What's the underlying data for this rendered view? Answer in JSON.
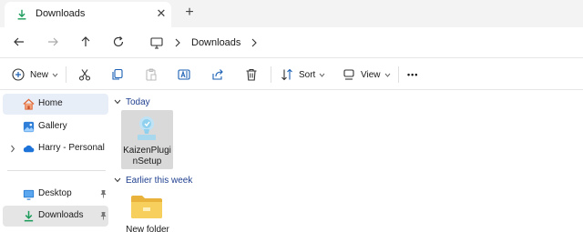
{
  "tab": {
    "title": "Downloads",
    "icon": "download-icon",
    "close_glyph": "✕",
    "new_tab_glyph": "+"
  },
  "address": {
    "path_label": "Downloads",
    "root_icon": "this-pc-icon"
  },
  "toolbar": {
    "new_label": "New",
    "sort_label": "Sort",
    "view_label": "View",
    "more_glyph": "•••"
  },
  "sidebar": {
    "items": [
      {
        "label": "Home",
        "icon": "home-icon"
      },
      {
        "label": "Gallery",
        "icon": "gallery-icon"
      },
      {
        "label": "Harry - Personal",
        "icon": "onedrive-icon"
      },
      {
        "label": "Desktop",
        "icon": "desktop-icon",
        "pinned": true
      },
      {
        "label": "Downloads",
        "icon": "download-icon",
        "pinned": true
      }
    ]
  },
  "content": {
    "groups": [
      {
        "title": "Today",
        "items": [
          {
            "name": "KaizenPluginSetup",
            "icon": "installer-icon"
          }
        ]
      },
      {
        "title": "Earlier this week",
        "items": [
          {
            "name": "New folder",
            "icon": "folder-icon"
          }
        ]
      }
    ]
  },
  "colors": {
    "accent": "#1f3f8f",
    "download_green": "#1b9b5a",
    "selected_bg": "#e8eef8",
    "active_bg": "#e5e5e5",
    "folder_yellow": "#f5c542"
  }
}
